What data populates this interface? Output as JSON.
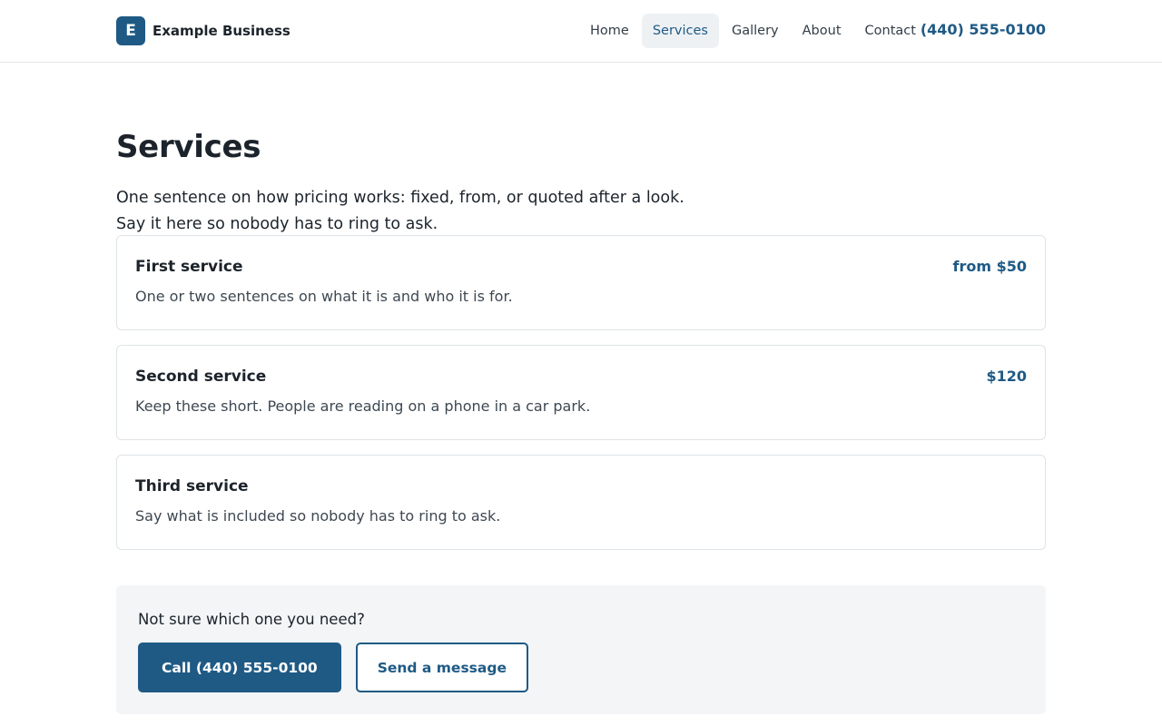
{
  "header": {
    "brand_initial": "E",
    "brand_name": "Example Business",
    "nav": [
      {
        "label": "Home",
        "active": false
      },
      {
        "label": "Services",
        "active": true
      },
      {
        "label": "Gallery",
        "active": false
      },
      {
        "label": "About",
        "active": false
      },
      {
        "label": "Contact",
        "active": false
      }
    ],
    "phone": "(440) 555-0100"
  },
  "main": {
    "title": "Services",
    "intro": "One sentence on how pricing works: fixed, from, or quoted after a look. Say it here so nobody has to ring to ask."
  },
  "services": [
    {
      "title": "First service",
      "price": "from $50",
      "description": "One or two sentences on what it is and who it is for."
    },
    {
      "title": "Second service",
      "price": "$120",
      "description": "Keep these short. People are reading on a phone in a car park."
    },
    {
      "title": "Third service",
      "price": "",
      "description": "Say what is included so nobody has to ring to ask."
    }
  ],
  "cta": {
    "question": "Not sure which one you need?",
    "call_label": "Call (440) 555-0100",
    "message_label": "Send a message"
  },
  "colors": {
    "accent": "#1f5a85",
    "text": "#1c232b",
    "muted_text": "#3e4852",
    "border": "#dfe3e7",
    "panel_bg": "#f3f5f7",
    "nav_active_bg": "#eef1f4"
  }
}
